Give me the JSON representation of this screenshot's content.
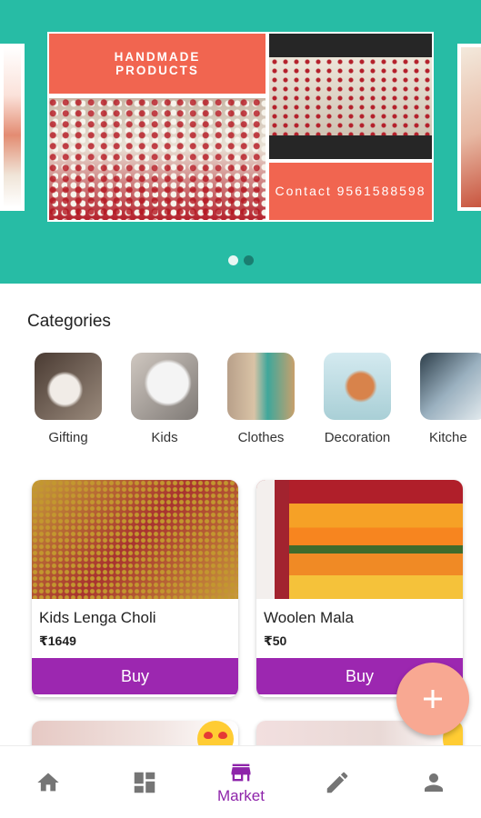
{
  "banner": {
    "title_text": "HANDMADE PRODUCTS",
    "contact_text": "Contact 9561588598",
    "slide_count": 2,
    "active_slide": 1
  },
  "categories": {
    "heading": "Categories",
    "items": [
      {
        "label": "Gifting"
      },
      {
        "label": "Kids"
      },
      {
        "label": "Clothes"
      },
      {
        "label": "Decoration"
      },
      {
        "label": "Kitche"
      }
    ]
  },
  "products": [
    {
      "name": "Kids Lenga Choli",
      "price": "₹1649",
      "button_label": "Buy"
    },
    {
      "name": "Woolen Mala",
      "price": "₹50",
      "button_label": "Buy"
    }
  ],
  "fab": {
    "icon": "plus-icon"
  },
  "bottom_nav": {
    "items": [
      {
        "icon": "home-icon",
        "label": ""
      },
      {
        "icon": "dashboard-icon",
        "label": ""
      },
      {
        "icon": "store-icon",
        "label": "Market",
        "active": true
      },
      {
        "icon": "edit-icon",
        "label": ""
      },
      {
        "icon": "person-icon",
        "label": ""
      }
    ]
  },
  "colors": {
    "banner_bg": "#27bca5",
    "accent_purple": "#9c27b0",
    "nav_active": "#8e24aa",
    "fab": "#f8a892",
    "banner_panel": "#f16550"
  }
}
